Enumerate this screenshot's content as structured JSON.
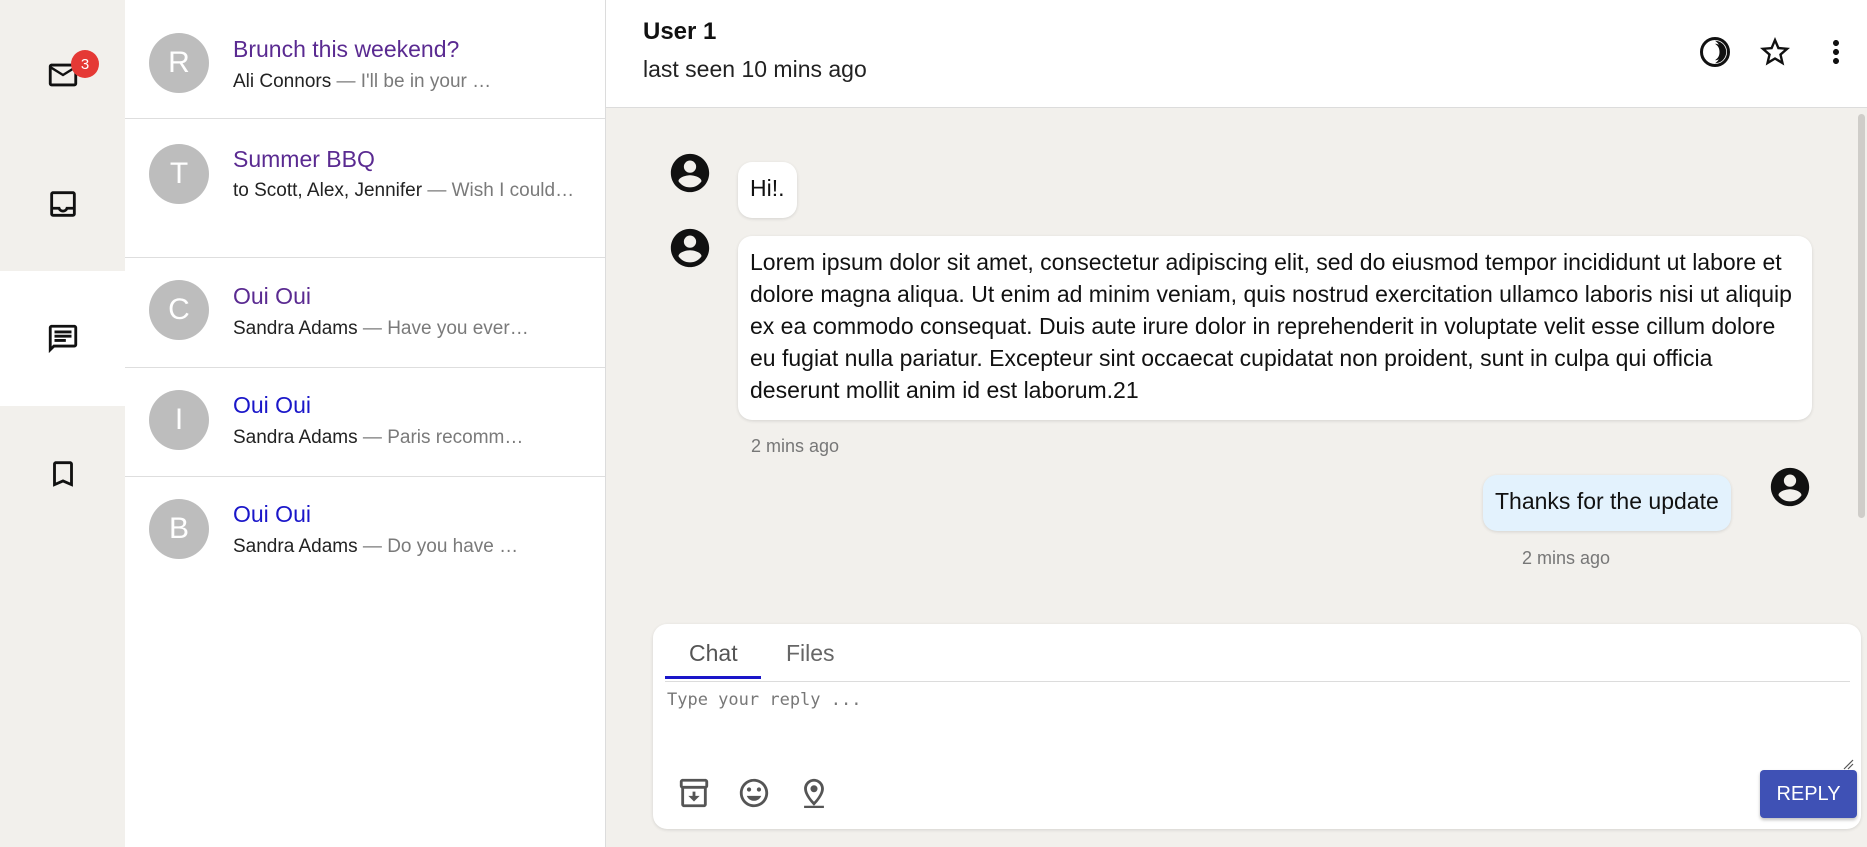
{
  "nav": {
    "mail_badge": "3",
    "items": [
      {
        "icon": "mail-icon"
      },
      {
        "icon": "inbox-icon"
      },
      {
        "icon": "chat-icon",
        "active": true
      },
      {
        "icon": "bookmark-icon"
      }
    ]
  },
  "messages": [
    {
      "initial": "R",
      "title": "Brunch this weekend?",
      "from": "Ali Connors",
      "snippet": " — I'll be in your …"
    },
    {
      "initial": "T",
      "title": "Summer BBQ",
      "from": "to Scott, Alex, Jennifer",
      "snippet": " — Wish I could…"
    },
    {
      "initial": "C",
      "title": "Oui Oui",
      "from": "Sandra Adams",
      "snippet": " — Have you ever…"
    },
    {
      "initial": "I",
      "title": "Oui Oui",
      "from": "Sandra Adams",
      "snippet": " — Paris recomm…"
    },
    {
      "initial": "B",
      "title": "Oui Oui",
      "from": "Sandra Adams",
      "snippet": " — Do you have …"
    }
  ],
  "chat": {
    "user_name": "User 1",
    "last_seen": "last seen 10 mins ago",
    "header_icons": [
      "theme-contrast-icon",
      "star-icon",
      "more-vert-icon"
    ],
    "thread": [
      {
        "text": "Hi!.",
        "time": ""
      },
      {
        "text": "Lorem ipsum dolor sit amet, consectetur adipiscing elit, sed do eiusmod tempor incididunt ut labore et dolore magna aliqua. Ut enim ad minim veniam, quis nostrud exercitation ullamco laboris nisi ut aliquip ex ea commodo consequat. Duis aute irure dolor in reprehenderit in voluptate velit esse cillum dolore eu fugiat nulla pariatur. Excepteur sint occaecat cupidatat non proident, sunt in culpa qui officia deserunt mollit anim id est laborum.21",
        "time": "2 mins ago"
      },
      {
        "text": "Thanks for the update",
        "time": "2 mins ago"
      }
    ]
  },
  "composer": {
    "tabs": [
      "Chat",
      "Files"
    ],
    "active_tab": "Chat",
    "placeholder": "Type your reply ...",
    "tool_icons": [
      "archive-download-icon",
      "emoji-icon",
      "location-pin-icon"
    ],
    "reply_label": "REPLY"
  },
  "colors": {
    "accent": "#3f51b5",
    "tab_underline": "#1a16c9",
    "badge": "#e53935",
    "visited_link": "#5a2a91",
    "unread_link": "#1a16c9",
    "own_bubble": "#e3f2fd"
  }
}
